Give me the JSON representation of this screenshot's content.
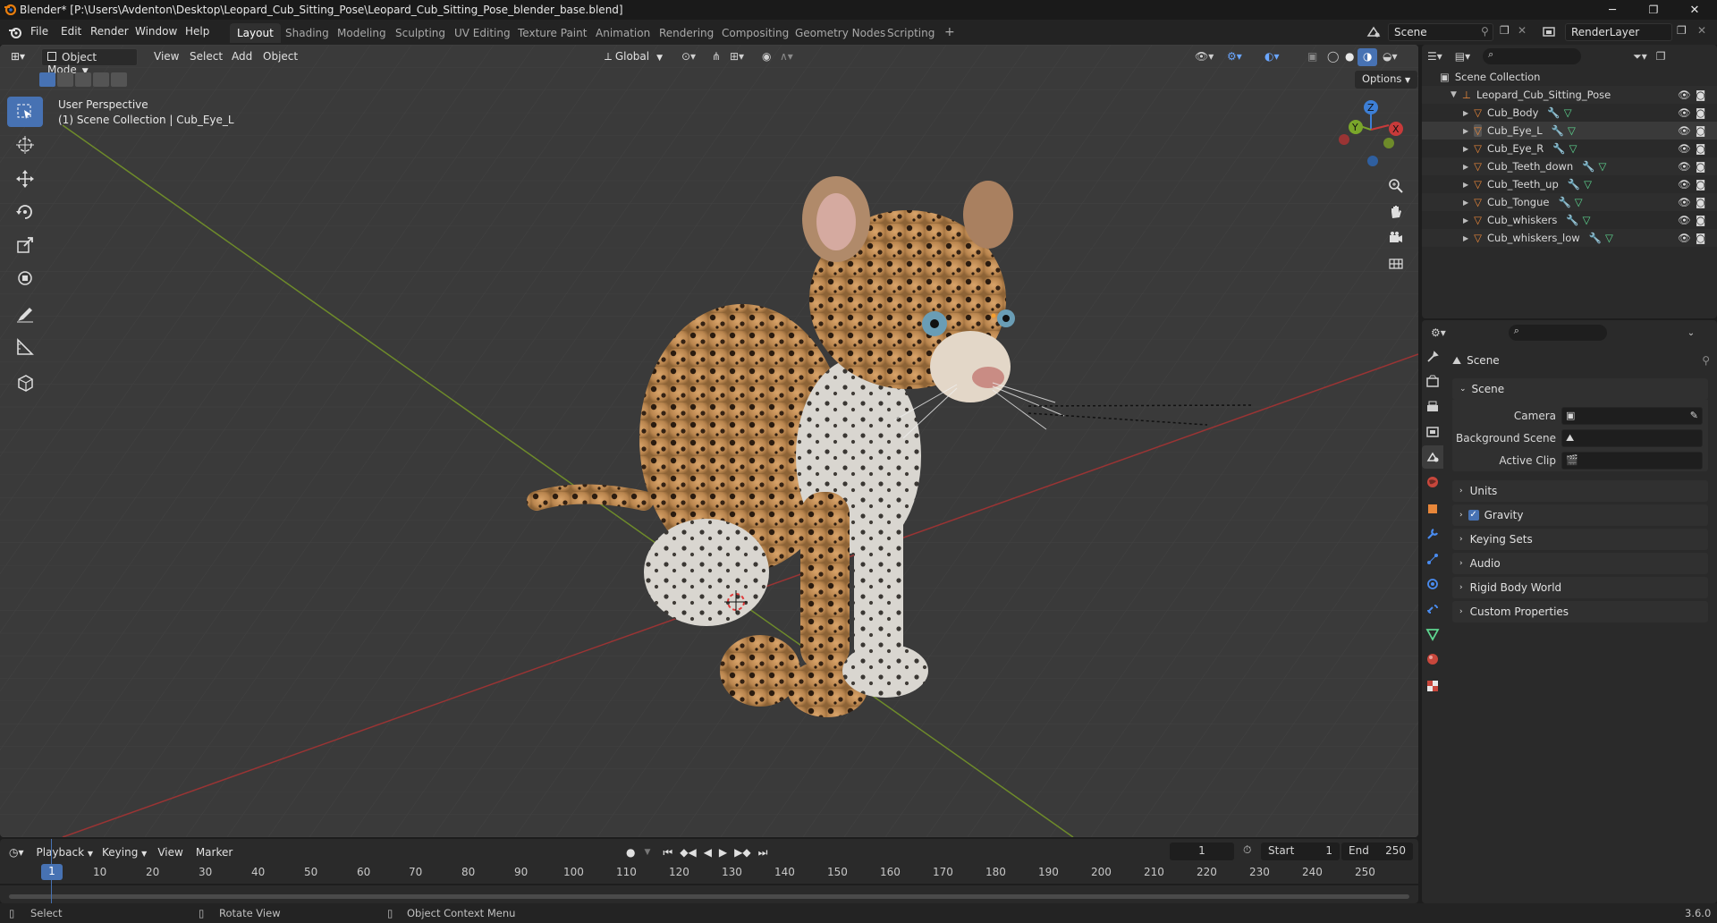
{
  "window": {
    "title": "Blender* [P:\\Users\\Avdenton\\Desktop\\Leopard_Cub_Sitting_Pose\\Leopard_Cub_Sitting_Pose_blender_base.blend]",
    "minimize": "─",
    "maximize": "❐",
    "close": "✕"
  },
  "menu": {
    "items": [
      "File",
      "Edit",
      "Render",
      "Window",
      "Help"
    ],
    "workspaces": [
      "Layout",
      "Shading",
      "Modeling",
      "Sculpting",
      "UV Editing",
      "Texture Paint",
      "Animation",
      "Rendering",
      "Compositing",
      "Geometry Nodes",
      "Scripting"
    ],
    "add_tab": "+",
    "scene": "Scene",
    "view_layer": "RenderLayer"
  },
  "viewport": {
    "mode": "Object Mode",
    "menus": [
      "View",
      "Select",
      "Add",
      "Object"
    ],
    "orientation": "Global",
    "options": "Options",
    "perspective": "User Perspective",
    "collection_info": "(1) Scene Collection | Cub_Eye_L",
    "gizmo": {
      "x": "X",
      "y": "Y",
      "z": "Z"
    }
  },
  "outliner": {
    "root": "Scene Collection",
    "collection": "Leopard_Cub_Sitting_Pose",
    "objects": [
      "Cub_Body",
      "Cub_Eye_L",
      "Cub_Eye_R",
      "Cub_Teeth_down",
      "Cub_Teeth_up",
      "Cub_Tongue",
      "Cub_whiskers",
      "Cub_whiskers_low"
    ],
    "selected": "Cub_Eye_L"
  },
  "properties": {
    "context": "Scene",
    "panel_scene": "Scene",
    "camera_label": "Camera",
    "background_label": "Background Scene",
    "clip_label": "Active Clip",
    "panels": [
      "Units",
      "Gravity",
      "Keying Sets",
      "Audio",
      "Rigid Body World",
      "Custom Properties"
    ],
    "gravity_checked": true
  },
  "timeline": {
    "menus": [
      "Playback",
      "Keying",
      "View",
      "Marker"
    ],
    "current_frame": "1",
    "start_label": "Start",
    "start": "1",
    "end_label": "End",
    "end": "250",
    "ruler": [
      "1",
      "10",
      "20",
      "30",
      "40",
      "50",
      "60",
      "70",
      "80",
      "90",
      "100",
      "110",
      "120",
      "130",
      "140",
      "150",
      "160",
      "170",
      "180",
      "190",
      "200",
      "210",
      "220",
      "230",
      "240",
      "250"
    ]
  },
  "status": {
    "select": "Select",
    "rotate": "Rotate View",
    "context_menu": "Object Context Menu",
    "version": "3.6.0"
  },
  "colors": {
    "accent": "#4772b3",
    "x_axis": "#c83a3a",
    "y_axis": "#7aa62a",
    "z_axis": "#3d7fd6",
    "object_orange": "#e8873a",
    "mesh_green": "#5ed690"
  }
}
